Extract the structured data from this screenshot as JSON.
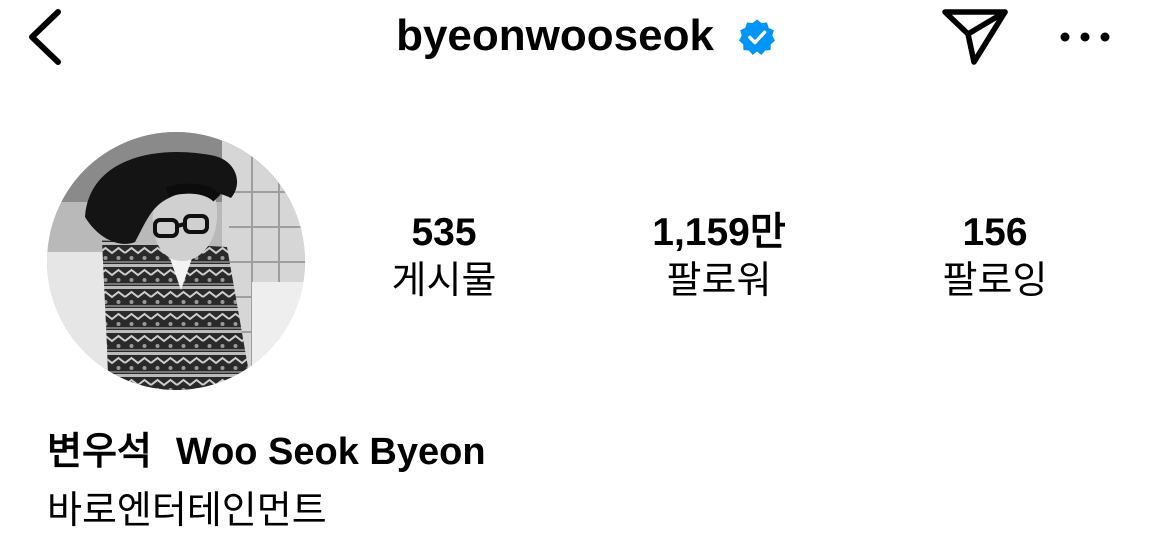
{
  "header": {
    "username": "byeonwooseok",
    "verified_icon": "verified-badge-icon",
    "back_icon": "chevron-left-icon",
    "send_icon": "paper-plane-icon",
    "more_icon": "ellipsis-icon",
    "badge_color": "#0095F6"
  },
  "profile": {
    "avatar_icon": "profile-photo"
  },
  "stats": [
    {
      "value": "535",
      "label": "게시물"
    },
    {
      "value": "1,159만",
      "label": "팔로워"
    },
    {
      "value": "156",
      "label": "팔로잉"
    }
  ],
  "bio": {
    "name_korean": "변우석",
    "name_english": "Woo Seok Byeon",
    "agency": "바로엔터테인먼트"
  }
}
